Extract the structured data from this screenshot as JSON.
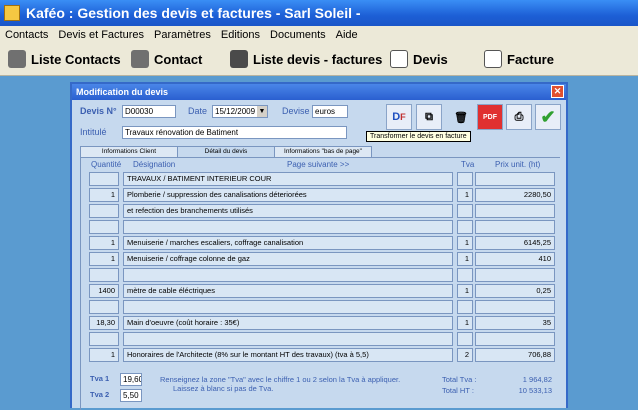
{
  "app": {
    "title": "Kaféo : Gestion des devis et factures     -    Sarl Soleil   -"
  },
  "menu": [
    "Contacts",
    "Devis et Factures",
    "Paramètres",
    "Editions",
    "Documents",
    "Aide"
  ],
  "toolbar": [
    {
      "label": "Liste Contacts",
      "icon": "users-icon"
    },
    {
      "label": "Contact",
      "icon": "user-icon"
    },
    {
      "label": "Liste devis - factures",
      "icon": "book-icon"
    },
    {
      "label": "Devis",
      "icon": "document-icon"
    },
    {
      "label": "Facture",
      "icon": "invoice-icon"
    }
  ],
  "dialog": {
    "title": "Modification du devis",
    "devis_label": "Devis N°",
    "devis_value": "D00030",
    "date_label": "Date",
    "date_value": "15/12/2009",
    "devise_label": "Devise",
    "devise_value": "euros",
    "intitule_label": "Intitulé",
    "intitule_value": "Travaux rénovation de Batiment",
    "tooltip": "Transformer le devis en facture",
    "tabs": [
      "Informations Client",
      "Détail du devis",
      "Informations \"bas de page\""
    ],
    "headers": {
      "qty": "Quantité",
      "desig": "Désignation",
      "next": "Page suivante >>",
      "tva": "Tva",
      "price": "Prix unit. (ht)"
    },
    "rows": [
      {
        "qty": "",
        "desig": "TRAVAUX / BATIMENT INTERIEUR COUR",
        "tva": "",
        "price": ""
      },
      {
        "qty": "1",
        "desig": "Plomberie / suppression des canalisations déteriorées",
        "tva": "1",
        "price": "2280,50"
      },
      {
        "qty": "",
        "desig": "et refection des branchements utilisés",
        "tva": "",
        "price": ""
      },
      {
        "qty": "",
        "desig": "",
        "tva": "",
        "price": ""
      },
      {
        "qty": "1",
        "desig": "Menuiserie / marches escaliers, coffrage canalisation",
        "tva": "1",
        "price": "6145,25"
      },
      {
        "qty": "1",
        "desig": "Menuiserie /  coffrage colonne de gaz",
        "tva": "1",
        "price": "410"
      },
      {
        "qty": "",
        "desig": "",
        "tva": "",
        "price": ""
      },
      {
        "qty": "1400",
        "desig": "mètre de cable éléctriques",
        "tva": "1",
        "price": "0,25"
      },
      {
        "qty": "",
        "desig": "",
        "tva": "",
        "price": ""
      },
      {
        "qty": "18,30",
        "desig": "Main d'oeuvre (coût horaire : 35€)",
        "tva": "1",
        "price": "35"
      },
      {
        "qty": "",
        "desig": "",
        "tva": "",
        "price": ""
      },
      {
        "qty": "1",
        "desig": "Honoraires de l'Architecte (8% sur le montant HT des travaux) (tva à 5,5)",
        "tva": "2",
        "price": "706,88"
      }
    ],
    "tva1_label": "Tva 1",
    "tva1_value": "19,60",
    "tva2_label": "Tva 2",
    "tva2_value": "5,50",
    "help1": "Renseignez la zone \"Tva\" avec le chiffre 1 ou 2 selon la Tva à appliquer.",
    "help2": "Laissez à blanc si pas de Tva.",
    "total_tva_label": "Total Tva :",
    "total_tva_value": "1 964,82",
    "total_ht_label": "Total HT :",
    "total_ht_value": "10 533,13"
  }
}
